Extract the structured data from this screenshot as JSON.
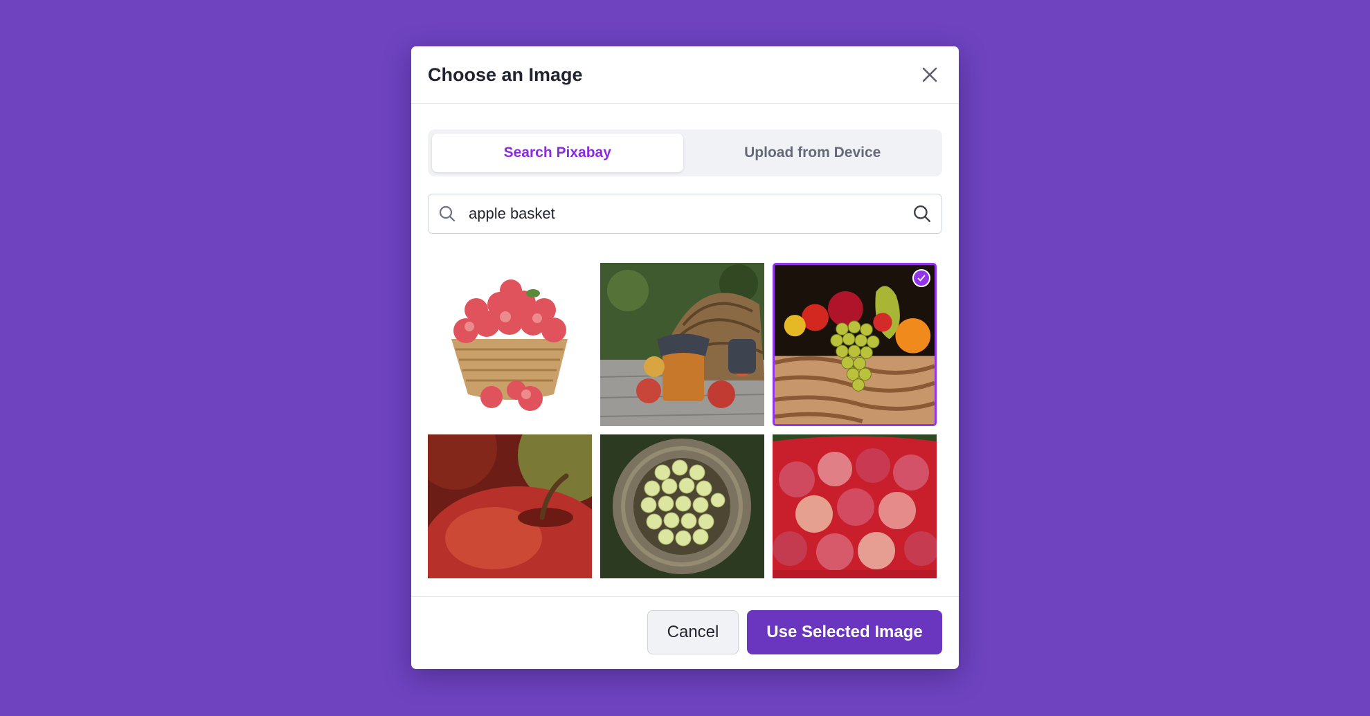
{
  "modal": {
    "title": "Choose an Image",
    "close_icon": "close-icon"
  },
  "tabs": [
    {
      "label": "Search Pixabay",
      "active": true
    },
    {
      "label": "Upload from Device",
      "active": false
    }
  ],
  "search": {
    "value": "apple basket",
    "leading_icon": "search-icon",
    "trailing_icon": "search-icon"
  },
  "results": [
    {
      "subject": "basket of red apples on white",
      "selected": false
    },
    {
      "subject": "overturned basket with jar and apples",
      "selected": false
    },
    {
      "subject": "fruit basket with grapes",
      "selected": true
    },
    {
      "subject": "close-up red apple",
      "selected": false
    },
    {
      "subject": "wicker basket of green apples",
      "selected": false
    },
    {
      "subject": "red tub of apples",
      "selected": false
    }
  ],
  "footer": {
    "cancel_label": "Cancel",
    "confirm_label": "Use Selected Image"
  },
  "colors": {
    "background": "#6f43c0",
    "accent": "#9333ea",
    "primary_button": "#6a36c0"
  }
}
